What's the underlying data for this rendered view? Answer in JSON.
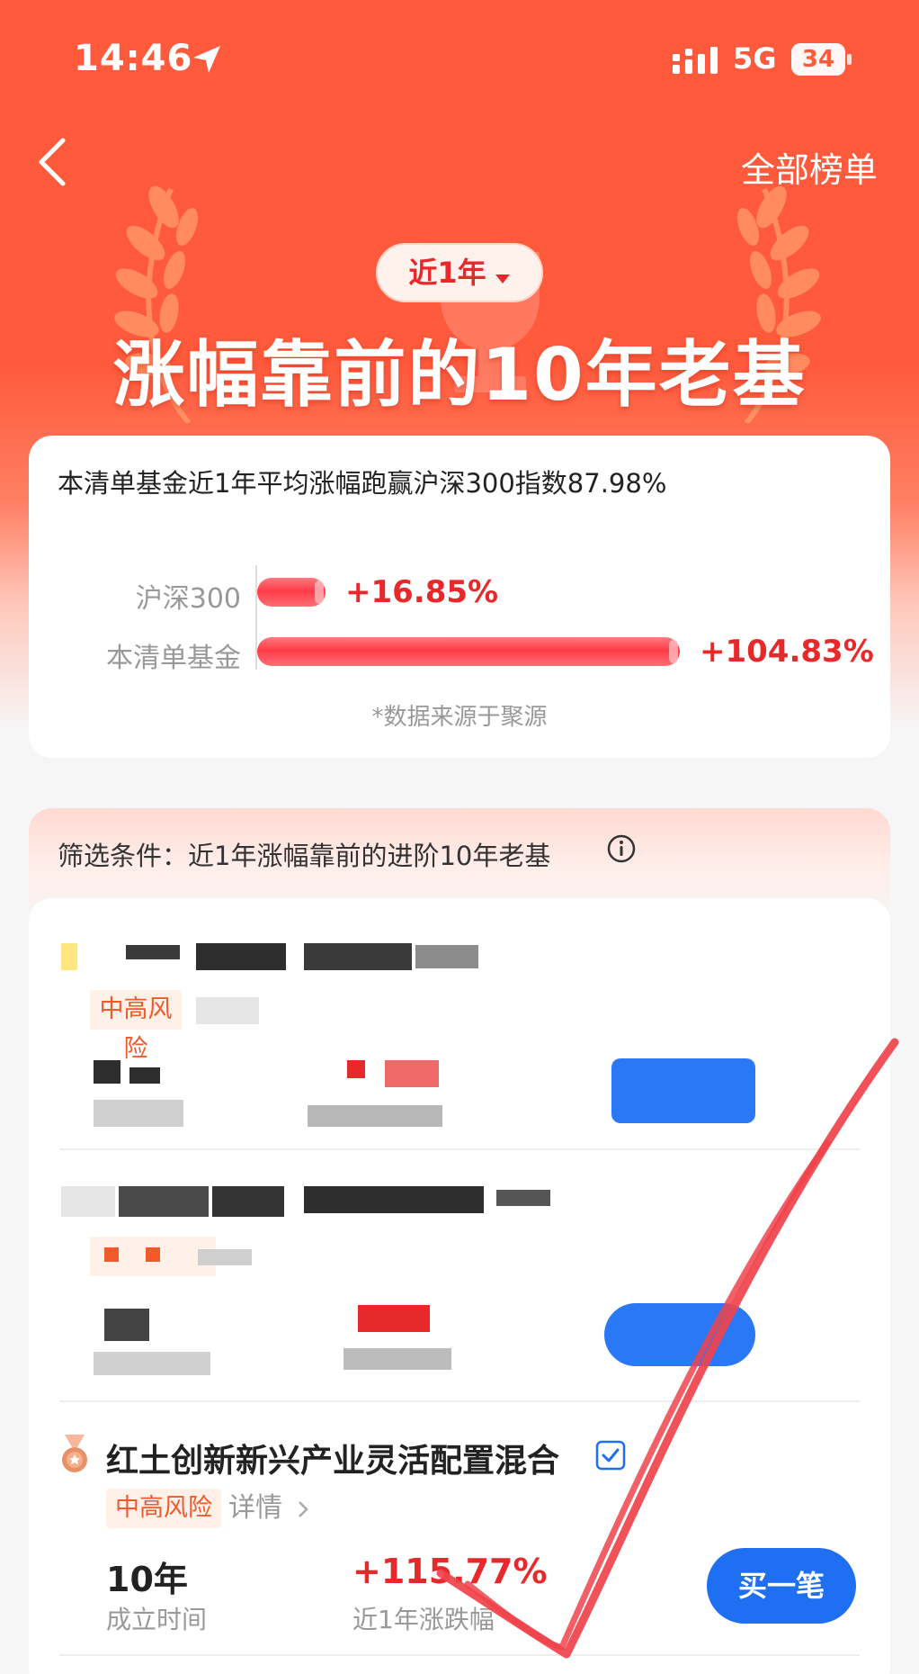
{
  "status_bar": {
    "time": "14:46",
    "network": "5G",
    "battery": "34"
  },
  "header": {
    "all_lists": "全部榜单"
  },
  "hero": {
    "period": "近1年",
    "title": "涨幅靠前的10年老基"
  },
  "summary_card": {
    "headline": "本清单基金近1年平均涨幅跑赢沪深300指数87.98%",
    "source_note": "*数据来源于聚源",
    "chart_data": {
      "type": "bar",
      "categories": [
        "沪深300",
        "本清单基金"
      ],
      "values": [
        16.85,
        104.83
      ],
      "value_labels": [
        "+16.85%",
        "+104.83%"
      ],
      "unit": "%"
    }
  },
  "filter": {
    "text": "筛选条件：近1年涨幅靠前的进阶10年老基"
  },
  "funds": [
    {
      "name": "红土创新新兴产业灵活配置混合",
      "risk": "中高风险",
      "detail": "详情",
      "established": "10年",
      "established_label": "成立时间",
      "return": "+115.77%",
      "return_label": "近1年涨跌幅",
      "buy": "买一笔"
    }
  ],
  "colors": {
    "accent": "#ff5a3c",
    "rise": "#e8292b",
    "buy": "#1e6ff2",
    "risk": "#f25a2a",
    "annotation": "#f0434b"
  },
  "icons": [
    "location-arrow-icon",
    "signal-icon",
    "battery-icon",
    "back-icon",
    "caret-down-icon",
    "info-icon",
    "bronze-medal-icon",
    "verified-icon",
    "chevron-right-icon"
  ]
}
